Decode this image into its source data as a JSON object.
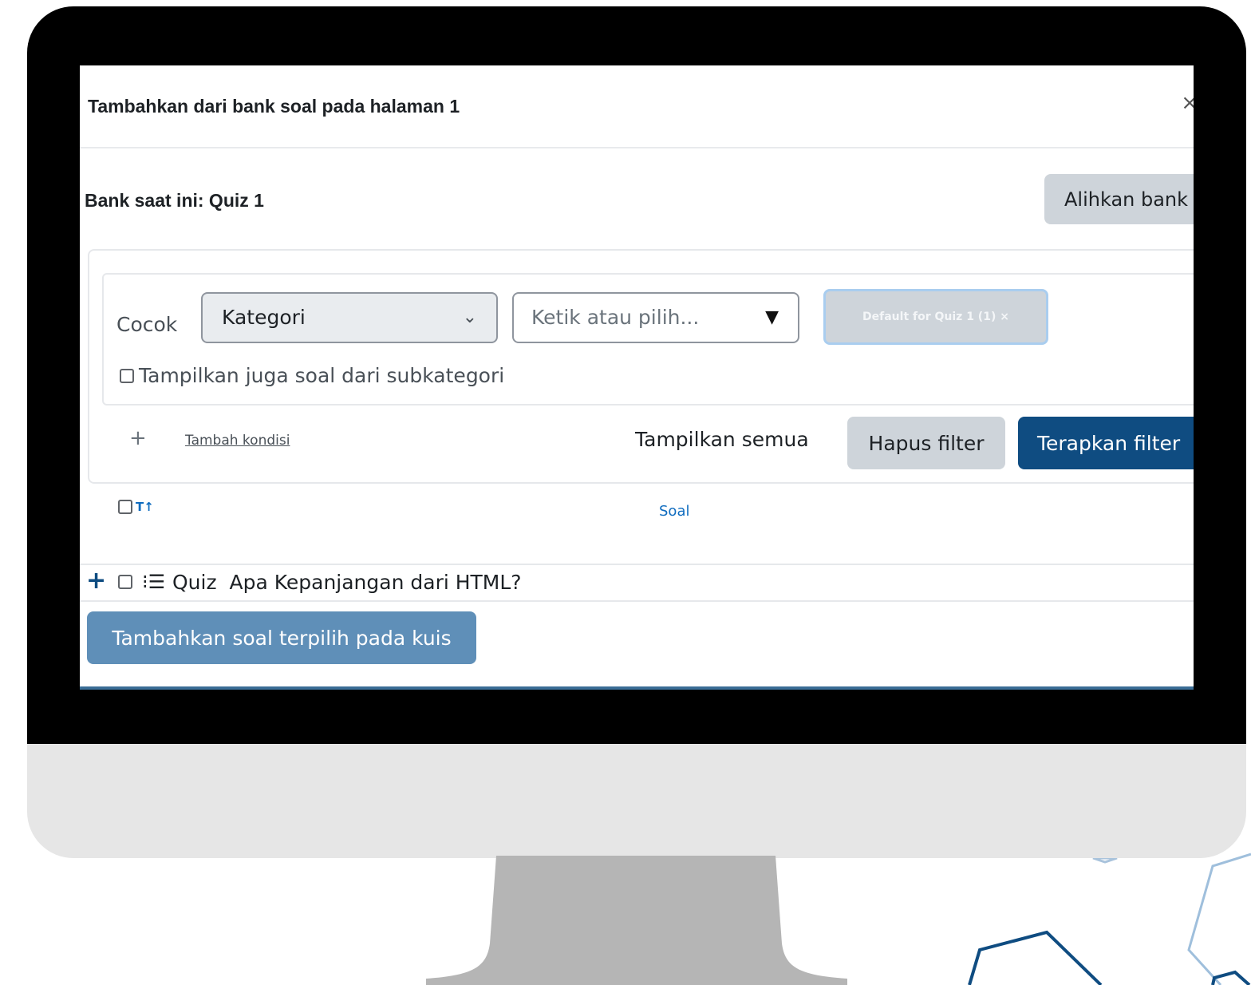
{
  "modal": {
    "title": "Tambahkan dari bank soal pada halaman 1",
    "close_glyph": "×"
  },
  "bank": {
    "current_label": "Bank saat ini: Quiz 1",
    "switch_button": "Alihkan bank"
  },
  "filter": {
    "match_label": "Cocok",
    "type_select_value": "Kategori",
    "value_placeholder": "Ketik atau pilih...",
    "selected_chip": "Default for Quiz 1 (1) ×",
    "subcategory_checkbox_label": "Tampilkan juga soal dari subkategori",
    "add_condition_plus": "+",
    "add_condition": "Tambah kondisi",
    "show_all": "Tampilkan semua",
    "clear_filter": "Hapus filter",
    "apply_filter": "Terapkan filter"
  },
  "table": {
    "type_sort_glyph": "T↑",
    "column_question": "Soal",
    "rows": [
      {
        "add_glyph": "+",
        "type_glyph": "⁝☰",
        "name": "Quiz  Apa Kepanjangan dari HTML?"
      }
    ]
  },
  "footer": {
    "add_selected_button": "Tambahkan soal terpilih pada kuis"
  },
  "colors": {
    "primary": "#0f4c81",
    "primary_disabled": "#5f8fb8",
    "secondary_button": "#ced4da",
    "monitor_bezel": "#000000",
    "monitor_chin": "#e6e6e6",
    "stand": "#b5b5b5"
  }
}
